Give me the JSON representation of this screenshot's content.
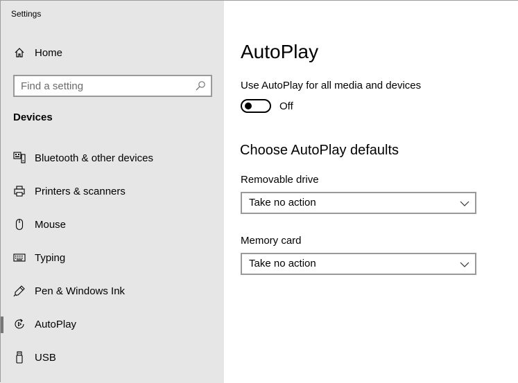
{
  "window": {
    "title": "Settings"
  },
  "sidebar": {
    "home_label": "Home",
    "search": {
      "placeholder": "Find a setting",
      "value": ""
    },
    "section_title": "Devices",
    "items": [
      {
        "label": "Bluetooth & other devices",
        "icon": "keyboard-device-icon"
      },
      {
        "label": "Printers & scanners",
        "icon": "printer-icon"
      },
      {
        "label": "Mouse",
        "icon": "mouse-icon"
      },
      {
        "label": "Typing",
        "icon": "keyboard-icon"
      },
      {
        "label": "Pen & Windows Ink",
        "icon": "pen-icon"
      },
      {
        "label": "AutoPlay",
        "icon": "autoplay-icon",
        "selected": true
      },
      {
        "label": "USB",
        "icon": "usb-icon"
      }
    ]
  },
  "main": {
    "title": "AutoPlay",
    "toggle": {
      "label": "Use AutoPlay for all media and devices",
      "state": "Off",
      "on": false
    },
    "defaults_heading": "Choose AutoPlay defaults",
    "removable_drive": {
      "label": "Removable drive",
      "value": "Take no action"
    },
    "memory_card": {
      "label": "Memory card",
      "value": "Take no action"
    }
  }
}
